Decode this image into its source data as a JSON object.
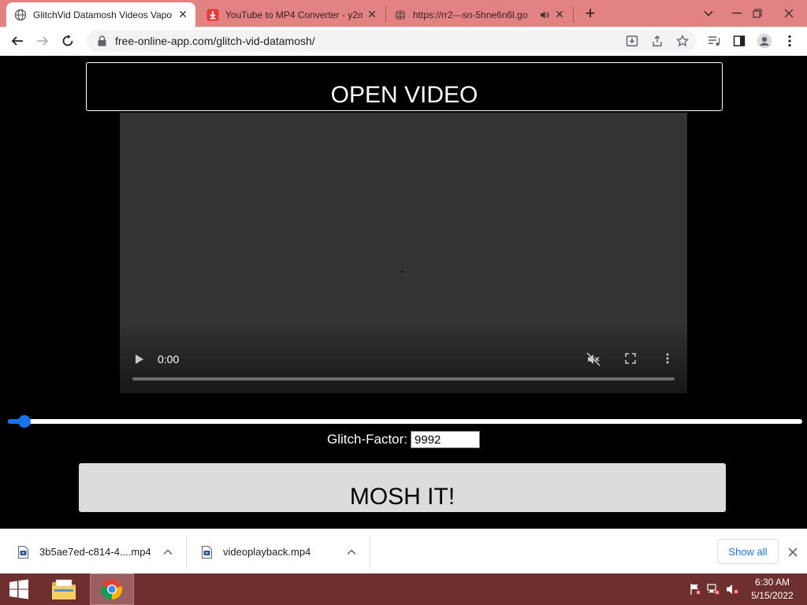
{
  "browser": {
    "tabs": [
      {
        "title": "GlitchVid Datamosh Videos Vapo",
        "active": true,
        "favicon": "globe-icon"
      },
      {
        "title": "YouTube to MP4 Converter - y2m",
        "active": false,
        "favicon": "download-favicon"
      },
      {
        "title": "https://rr2---sn-5hne6n6l.go",
        "active": false,
        "favicon": "globe-icon",
        "audio": "speaker-icon"
      }
    ],
    "new_tab": "+",
    "url": "free-online-app.com/glitch-vid-datamosh/"
  },
  "page": {
    "open_video_label": "OPEN VIDEO",
    "video": {
      "time": "0:00"
    },
    "glitch_slider": {
      "value_fraction": 0.013
    },
    "glitch_factor": {
      "label": "Glitch-Factor:",
      "value": "9992"
    },
    "mosh_label": "MOSH IT!"
  },
  "downloads": {
    "items": [
      {
        "name": "3b5ae7ed-c814-4....mp4"
      },
      {
        "name": "videoplayback.mp4"
      }
    ],
    "show_all": "Show all"
  },
  "taskbar": {
    "time": "6:30 AM",
    "date": "5/15/2022"
  },
  "colors": {
    "tabstrip": "#e38282",
    "taskbar": "#6e2f2f",
    "accent": "#1a73e8"
  }
}
